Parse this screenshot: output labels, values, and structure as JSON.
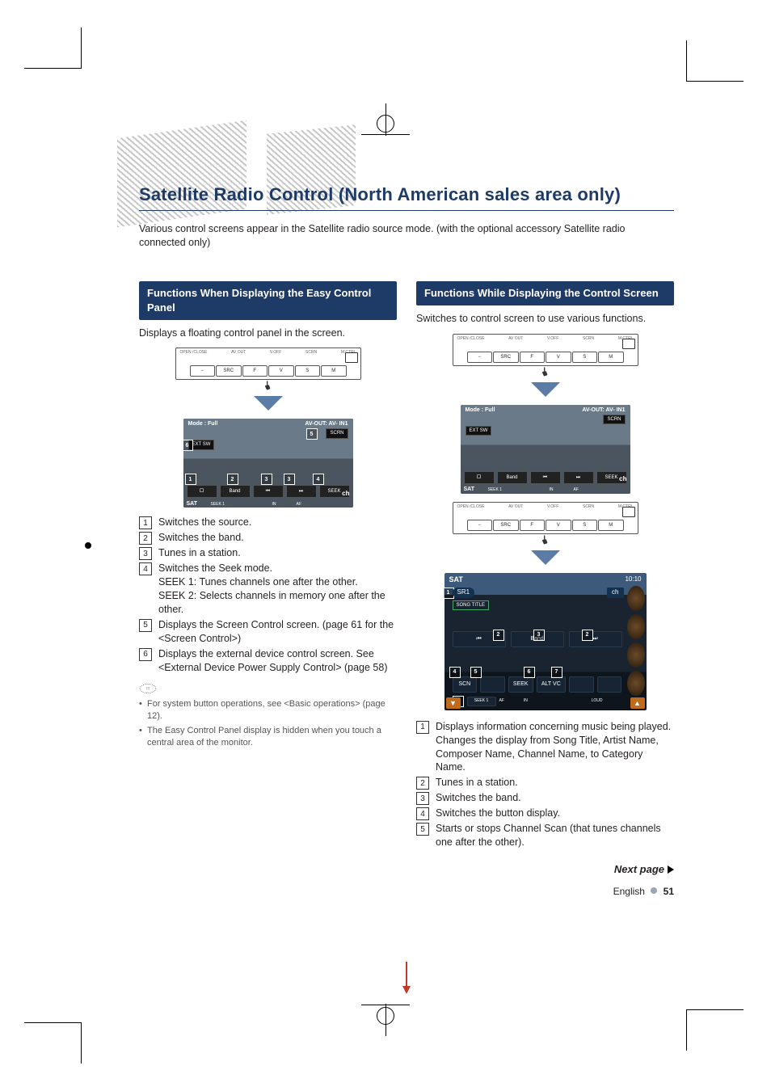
{
  "title": "Satellite Radio Control (North American sales area only)",
  "intro": "Various control screens appear in the Satellite radio source mode. (with the optional accessory Satellite radio connected only)",
  "left": {
    "heading": "Functions When Displaying the Easy Control Panel",
    "lead": "Displays a floating control panel in the screen.",
    "device_labels": {
      "open": "OPEN\n/CLOSE",
      "avout": "AV OUT",
      "voff": "V.OFF",
      "scrn": "SCRN",
      "mctrl": "M.CTRL",
      "minus": "−",
      "src": "SRC",
      "f": "F",
      "v": "V",
      "s": "S",
      "m": "M"
    },
    "shot": {
      "mode": "Mode : Full",
      "avout": "AV-OUT: AV- IN1",
      "scrn": "SCRN",
      "ext": "EXT SW",
      "btns": [
        "ロ",
        "Band",
        "⏮",
        "⏭",
        "SEEK"
      ],
      "sat": "SAT",
      "ch": "ch",
      "seek": "SEEK 1",
      "in": "IN",
      "af": "AF"
    },
    "items": [
      {
        "n": "1",
        "text": "Switches the source."
      },
      {
        "n": "2",
        "text": "Switches the band."
      },
      {
        "n": "3",
        "text": "Tunes in a station."
      },
      {
        "n": "4",
        "text": "Switches the Seek mode.",
        "subs": [
          "SEEK 1: Tunes channels one after the other.",
          "SEEK 2: Selects channels in memory one after the other."
        ]
      },
      {
        "n": "5",
        "text": "Displays the Screen Control screen. (page 61 for the <Screen Control>)"
      },
      {
        "n": "6",
        "text": "Displays the external device control screen. See <External Device Power Supply Control> (page 58)"
      }
    ],
    "notes": [
      "For system button operations, see <Basic operations> (page 12).",
      "The Easy Control Panel display is hidden when you touch a central area of the monitor."
    ]
  },
  "right": {
    "heading": "Functions While Displaying the Control Screen",
    "lead": "Switches  to control screen to use various functions.",
    "shot": {
      "mode": "Mode : Full",
      "avout": "AV-OUT: AV- IN1",
      "scrn": "SCRN",
      "ext": "EXT SW",
      "btns": [
        "ロ",
        "Band",
        "⏮",
        "⏭",
        "SEEK"
      ],
      "sat": "SAT",
      "ch": "ch",
      "seek": "SEEK 1",
      "in": "IN",
      "af": "AF"
    },
    "big": {
      "hdr": "SAT",
      "time": "10:10",
      "sr1": "SR1",
      "ch": "ch",
      "song": "SONG TITLE",
      "row1": [
        "⏮",
        "Band",
        "⏭"
      ],
      "row2": [
        "SCN",
        "",
        "SEEK",
        "ALT VC",
        "",
        ""
      ],
      "row3_seek": "SEEK 1",
      "af": "AF",
      "in": "IN",
      "loud": "LOUD"
    },
    "items": [
      {
        "n": "1",
        "text": "Displays information concerning music being played.",
        "subs": [
          "Changes the display from Song Title, Artist Name, Composer Name, Channel Name, to Category Name."
        ]
      },
      {
        "n": "2",
        "text": "Tunes in a station."
      },
      {
        "n": "3",
        "text": "Switches the band."
      },
      {
        "n": "4",
        "text": "Switches the button display."
      },
      {
        "n": "5",
        "text": "Starts or stops Channel Scan (that tunes channels one after the other)."
      }
    ]
  },
  "next_page": "Next page",
  "footer": {
    "lang": "English",
    "page": "51"
  }
}
